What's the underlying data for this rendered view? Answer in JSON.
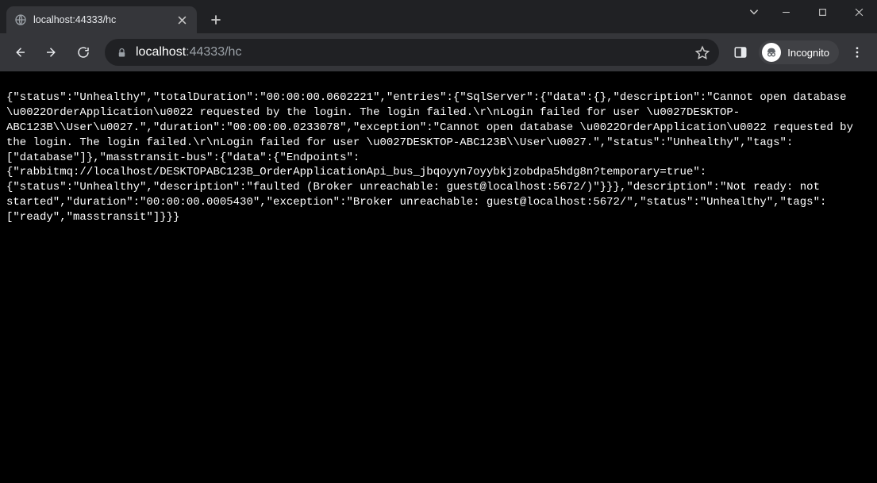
{
  "window": {
    "tab_title": "localhost:44333/hc",
    "incognito_label": "Incognito"
  },
  "url": {
    "host": "localhost",
    "port_path": ":44333/hc"
  },
  "page": {
    "raw_text": "{\"status\":\"Unhealthy\",\"totalDuration\":\"00:00:00.0602221\",\"entries\":{\"SqlServer\":{\"data\":{},\"description\":\"Cannot open database \\u0022OrderApplication\\u0022 requested by the login. The login failed.\\r\\nLogin failed for user \\u0027DESKTOP-ABC123B\\\\User\\u0027.\",\"duration\":\"00:00:00.0233078\",\"exception\":\"Cannot open database \\u0022OrderApplication\\u0022 requested by the login. The login failed.\\r\\nLogin failed for user \\u0027DESKTOP-ABC123B\\\\User\\u0027.\",\"status\":\"Unhealthy\",\"tags\":[\"database\"]},\"masstransit-bus\":{\"data\":{\"Endpoints\":{\"rabbitmq://localhost/DESKTOPABC123B_OrderApplicationApi_bus_jbqoyyn7oyybkjzobdpa5hdg8n?temporary=true\":{\"status\":\"Unhealthy\",\"description\":\"faulted (Broker unreachable: guest@localhost:5672/)\"}}},\"description\":\"Not ready: not started\",\"duration\":\"00:00:00.0005430\",\"exception\":\"Broker unreachable: guest@localhost:5672/\",\"status\":\"Unhealthy\",\"tags\":[\"ready\",\"masstransit\"]}}}"
  },
  "icons": {
    "back": "back-icon",
    "forward": "forward-icon",
    "reload": "reload-icon",
    "lock": "lock-icon",
    "star": "star-icon",
    "panel": "side-panel-icon",
    "incognito": "incognito-icon",
    "menu": "menu-icon",
    "newtab": "plus-icon",
    "tabclose": "close-icon",
    "chevron": "chevron-down-icon",
    "minimize": "window-minimize-icon",
    "maximize": "window-maximize-icon",
    "winclose": "window-close-icon",
    "globe": "globe-icon"
  }
}
